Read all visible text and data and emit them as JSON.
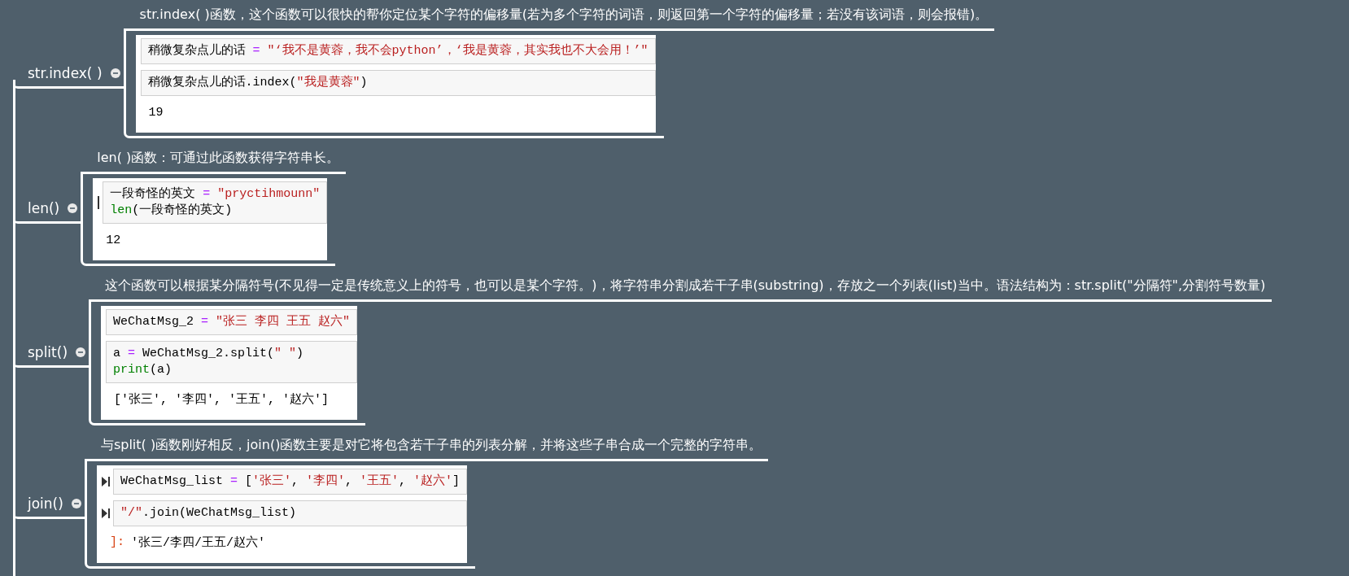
{
  "branches": [
    {
      "label": "str.index( )",
      "expanded": true,
      "description": "str.index( )函数，这个函数可以很快的帮你定位某个字符的偏移量(若为多个字符的词语，则返回第一个字符的偏移量；若没有该词语，则会报错)。",
      "cells": [
        {
          "kind": "input",
          "lines": [
            [
              {
                "kind": "name",
                "text": "稍微复杂点儿的话 "
              },
              {
                "kind": "op",
                "text": "="
              },
              {
                "kind": "string",
                "text": " \"‘我不是黄蓉，我不会python’，‘我是黄蓉，其实我也不大会用！’\""
              }
            ]
          ]
        },
        {
          "kind": "input",
          "lines": [
            [
              {
                "kind": "name",
                "text": "稍微复杂点儿的话.index("
              },
              {
                "kind": "string",
                "text": "\"我是黄蓉\""
              },
              {
                "kind": "name",
                "text": ")"
              }
            ]
          ]
        },
        {
          "kind": "output",
          "lines": [
            [
              {
                "kind": "name",
                "text": "19"
              }
            ]
          ]
        }
      ]
    },
    {
      "label": "len()",
      "expanded": true,
      "description": "len( )函数：可通过此函数获得字符串长。",
      "cells": [
        {
          "kind": "edit-input",
          "lines": [
            [
              {
                "kind": "name",
                "text": "一段奇怪的英文 "
              },
              {
                "kind": "op",
                "text": "="
              },
              {
                "kind": "string",
                "text": " \"pryctihmounn\""
              }
            ],
            [
              {
                "kind": "builtin",
                "text": "len"
              },
              {
                "kind": "name",
                "text": "(一段奇怪的英文)"
              }
            ]
          ]
        },
        {
          "kind": "output",
          "lines": [
            [
              {
                "kind": "name",
                "text": "12"
              }
            ]
          ]
        }
      ]
    },
    {
      "label": "split()",
      "expanded": true,
      "description": "这个函数可以根据某分隔符号(不见得一定是传统意义上的符号，也可以是某个字符。)，将字符串分割成若干子串(substring)，存放之一个列表(list)当中。语法结构为：str.split(\"分隔符\",分割符号数量)",
      "cells": [
        {
          "kind": "input",
          "lines": [
            [
              {
                "kind": "name",
                "text": "WeChatMsg_2 "
              },
              {
                "kind": "op",
                "text": "="
              },
              {
                "kind": "string",
                "text": " \"张三 李四 王五 赵六\""
              }
            ]
          ]
        },
        {
          "kind": "input",
          "lines": [
            [
              {
                "kind": "name",
                "text": "a "
              },
              {
                "kind": "op",
                "text": "="
              },
              {
                "kind": "name",
                "text": " WeChatMsg_2.split("
              },
              {
                "kind": "string",
                "text": "\" \""
              },
              {
                "kind": "name",
                "text": ")"
              }
            ],
            [
              {
                "kind": "builtin",
                "text": "print"
              },
              {
                "kind": "name",
                "text": "(a)"
              }
            ]
          ]
        },
        {
          "kind": "output",
          "lines": [
            [
              {
                "kind": "name",
                "text": "['张三', '李四', '王五', '赵六']"
              }
            ]
          ]
        }
      ]
    },
    {
      "label": "join()",
      "expanded": true,
      "description": "与split( )函数刚好相反，join()函数主要是对它将包含若干子串的列表分解，并将这些子串合成一个完整的字符串。",
      "cells": [
        {
          "kind": "run-input",
          "lines": [
            [
              {
                "kind": "name",
                "text": "WeChatMsg_list "
              },
              {
                "kind": "op",
                "text": "="
              },
              {
                "kind": "name",
                "text": " ["
              },
              {
                "kind": "string",
                "text": "'张三'"
              },
              {
                "kind": "name",
                "text": ", "
              },
              {
                "kind": "string",
                "text": "'李四'"
              },
              {
                "kind": "name",
                "text": ", "
              },
              {
                "kind": "string",
                "text": "'王五'"
              },
              {
                "kind": "name",
                "text": ", "
              },
              {
                "kind": "string",
                "text": "'赵六'"
              },
              {
                "kind": "name",
                "text": "]"
              }
            ]
          ]
        },
        {
          "kind": "run-input",
          "lines": [
            [
              {
                "kind": "string",
                "text": "\"/\""
              },
              {
                "kind": "name",
                "text": ".join(WeChatMsg_list)"
              }
            ]
          ]
        },
        {
          "kind": "output",
          "prompt": "]:",
          "lines": [
            [
              {
                "kind": "name",
                "text": "'张三/李四/王五/赵六'"
              }
            ]
          ]
        }
      ]
    }
  ]
}
